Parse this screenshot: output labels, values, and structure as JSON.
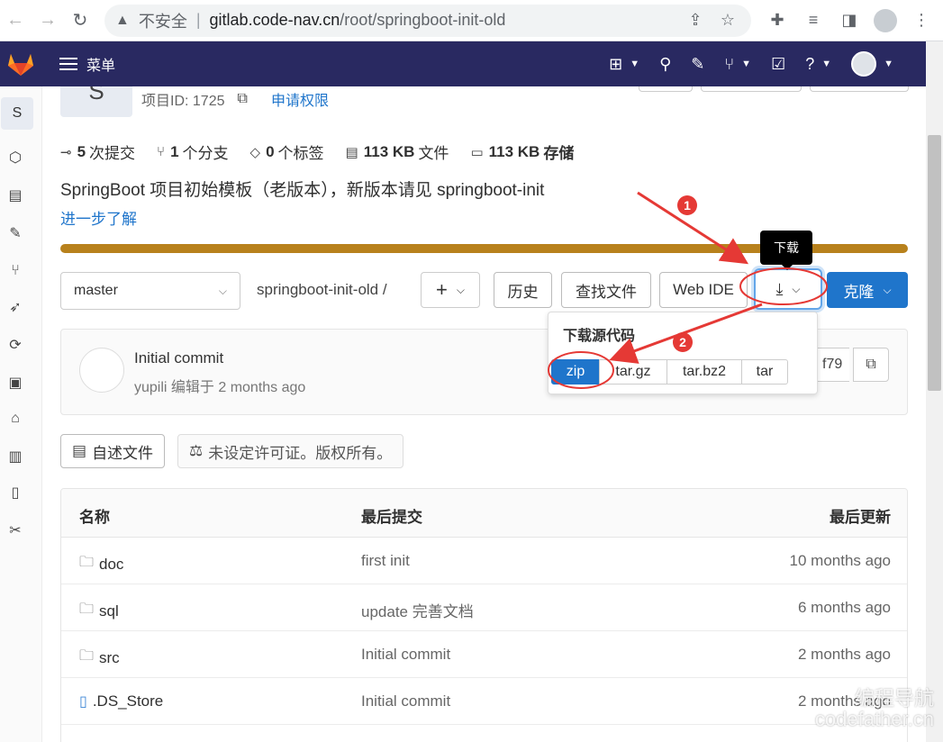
{
  "browser": {
    "insecure_label": "不安全",
    "url_host": "gitlab.code-nav.cn",
    "url_path": "/root/springboot-init-old"
  },
  "header": {
    "menu_label": "菜单"
  },
  "sidebar": {
    "avatar_letter": "S"
  },
  "project": {
    "avatar_letter": "S",
    "id_label": "项目ID: 1725",
    "request_access": "申请权限",
    "stats": {
      "commits": "5",
      "commits_label": "次提交",
      "branches": "1",
      "branches_label": "个分支",
      "tags": "0",
      "tags_label": "个标签",
      "files": "113 KB",
      "files_label": "文件",
      "storage": "113 KB",
      "storage_label": "存储"
    },
    "description": "SpringBoot 项目初始模板（老版本），新版本请见 springboot-init",
    "learn_more": "进一步了解",
    "progress_fraction": 1.0,
    "progress_color": "#b8811c"
  },
  "toolbar": {
    "branch": "master",
    "path": "springboot-init-old",
    "path_sep": "/",
    "plus": "+",
    "history": "历史",
    "find_file": "查找文件",
    "web_ide": "Web IDE",
    "clone": "克隆",
    "download_tooltip": "下载"
  },
  "download_menu": {
    "header": "下载源代码",
    "options": [
      "zip",
      "tar.gz",
      "tar.bz2",
      "tar"
    ]
  },
  "commit": {
    "title": "Initial commit",
    "author_time": "yupili 编辑于 2 months ago",
    "sha_tail": "f79"
  },
  "readme": {
    "readme_label": "自述文件",
    "license_label": "未设定许可证。版权所有。"
  },
  "table": {
    "headers": {
      "name": "名称",
      "last_commit": "最后提交",
      "last_update": "最后更新"
    },
    "rows": [
      {
        "name": "doc",
        "type": "folder",
        "commit": "first init",
        "time": "10 months ago"
      },
      {
        "name": "sql",
        "type": "folder",
        "commit": "update 完善文档",
        "time": "6 months ago"
      },
      {
        "name": "src",
        "type": "folder",
        "commit": "Initial commit",
        "time": "2 months ago"
      },
      {
        "name": ".DS_Store",
        "type": "file",
        "commit": "Initial commit",
        "time": "2 months ago"
      }
    ]
  },
  "annotations": {
    "marker1": "1",
    "marker2": "2",
    "color": "#e53935"
  },
  "watermark": {
    "cn": "编程导航",
    "en": "codefather.cn"
  },
  "colors": {
    "header_bg": "#292961",
    "accent": "#1f75cb"
  }
}
